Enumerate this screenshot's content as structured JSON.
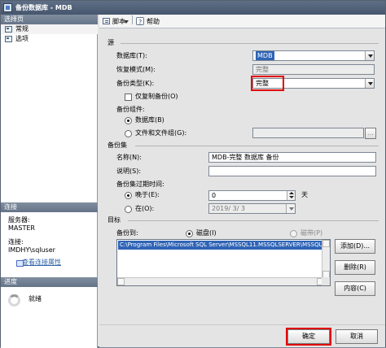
{
  "window": {
    "title": "备份数据库 - MDB"
  },
  "left_pane": {
    "select_page_header": "选择页",
    "pages": [
      "常规",
      "选项"
    ],
    "connection_header": "连接",
    "server_label": "服务器:",
    "server_value": "MASTER",
    "connection_label": "连接:",
    "connection_value": "IMDHY\\sqluser",
    "view_connection_properties": "查看连接属性",
    "progress_header": "进度",
    "progress_status": "就绪"
  },
  "toolbar": {
    "script_label": "脚本",
    "help_label": "帮助"
  },
  "source": {
    "heading": "源",
    "database_label": "数据库(T):",
    "database_value": "MDB",
    "recovery_model_label": "恢复模式(M):",
    "recovery_model_value": "完整",
    "backup_type_label": "备份类型(K):",
    "backup_type_value": "完整",
    "copy_only_label": "仅复制备份(O)",
    "backup_component_label": "备份组件:",
    "database_option_label": "数据库(B)",
    "files_option_label": "文件和文件组(G):"
  },
  "backup_set": {
    "heading": "备份集",
    "name_label": "名称(N):",
    "name_value": "MDB-完整 数据库 备份",
    "description_label": "说明(S):",
    "description_value": "",
    "expiration_label": "备份集过期时间:",
    "after_label": "晚于(E):",
    "after_value": "0",
    "days_label": "天",
    "on_label": "在(O):",
    "on_value": "2019/ 3/ 3"
  },
  "destination": {
    "heading": "目标",
    "backup_to_label": "备份到:",
    "disk_label": "磁盘(I)",
    "tape_label": "磁带(P)",
    "paths": [
      "C:\\Program Files\\Microsoft SQL Server\\MSSQL11.MSSQLSERVER\\MSSQL\\"
    ],
    "add_button": "添加(D)...",
    "remove_button": "删除(R)",
    "contents_button": "内容(C)"
  },
  "footer": {
    "ok_button": "确定",
    "cancel_button": "取消"
  },
  "colors": {
    "title_bar": "#4e5d74",
    "selection": "#2f64b6",
    "highlight_box": "#e00000",
    "link": "#2f63a8"
  },
  "icons": [
    "window-icon",
    "page-icon",
    "script-icon",
    "help-icon",
    "connection-properties-icon",
    "progress-spinner-icon"
  ]
}
